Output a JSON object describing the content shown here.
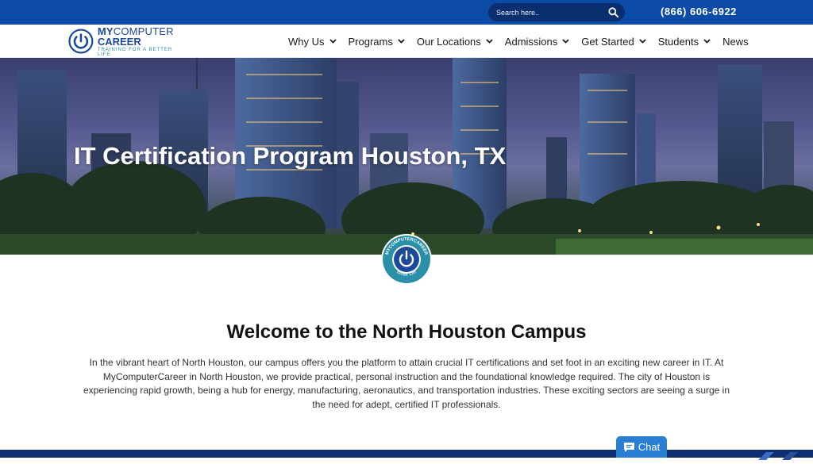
{
  "header": {
    "search": {
      "placeholder": "Search here.."
    },
    "phone": "(866) 606-6922"
  },
  "logo": {
    "line1_bold": "MY",
    "line1_rest": "COMPUTER",
    "line2": "CAREER",
    "tagline": "TRAINING FOR A BETTER LIFE"
  },
  "nav": {
    "items": [
      {
        "label": "Why Us",
        "dropdown": true
      },
      {
        "label": "Programs",
        "dropdown": true
      },
      {
        "label": "Our Locations",
        "dropdown": true
      },
      {
        "label": "Admissions",
        "dropdown": true
      },
      {
        "label": "Get Started",
        "dropdown": true
      },
      {
        "label": "Students",
        "dropdown": true
      },
      {
        "label": "News",
        "dropdown": false
      }
    ]
  },
  "hero": {
    "title": "IT Certification Program Houston, TX"
  },
  "badge": {
    "ring_text": "MYCOMPUTERCAREER",
    "bottom_text": "Better Life"
  },
  "welcome": {
    "title": "Welcome to the North Houston Campus",
    "body": "In the vibrant heart of North Houston, our campus offers you the platform to attain crucial IT certifications and set foot in an exciting new career in IT. At MyComputerCareer in North Houston, we provide practical, personal instruction and the foundational knowledge required. The city of Houston is experiencing rapid growth, being a hub for energy, manufacturing, aeronautics, and transportation industries. These exciting sectors are seeing a surge in the need for adept, certified IT professionals."
  },
  "chat": {
    "label": "Chat"
  },
  "colors": {
    "topbar": "#0d4ba8",
    "brand_blue": "#1b4a9c",
    "brand_teal": "#2a8fa8",
    "chat": "#2a7fd4"
  },
  "icons": {
    "search": "search-icon",
    "dropdown": "chevron-down-icon",
    "chat": "chat-bubble-icon",
    "logo": "power-icon"
  }
}
